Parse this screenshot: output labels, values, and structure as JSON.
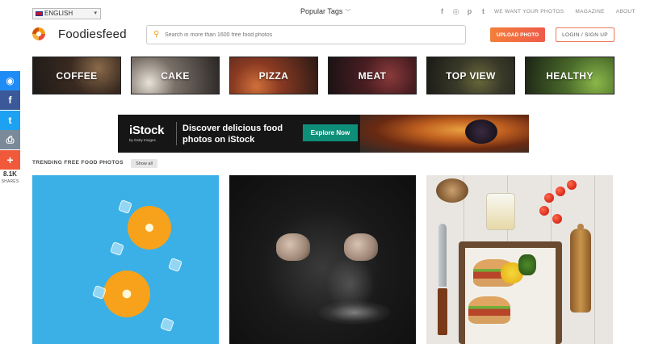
{
  "topbar": {
    "language": "ENGLISH",
    "popular_tags": "Popular Tags",
    "social_icons": [
      "facebook-icon",
      "instagram-icon",
      "pinterest-icon",
      "twitter-icon"
    ],
    "social_glyphs": [
      "f",
      "◎",
      "p",
      "t"
    ],
    "links": [
      "WE WANT YOUR PHOTOS",
      "MAGAZINE",
      "ABOUT"
    ]
  },
  "header": {
    "brand": "Foodiesfeed",
    "search_placeholder": "Search in more than 1600 free food photos",
    "upload_label": "UPLOAD PHOTO",
    "login_label": "LOGIN / SIGN UP"
  },
  "categories": [
    "COFFEE",
    "CAKE",
    "PIZZA",
    "MEAT",
    "TOP VIEW",
    "HEALTHY"
  ],
  "share_bar": {
    "buttons": [
      {
        "name": "messenger",
        "glyph": "◉"
      },
      {
        "name": "facebook",
        "glyph": "f"
      },
      {
        "name": "twitter",
        "glyph": "t"
      },
      {
        "name": "print",
        "glyph": "⎙"
      },
      {
        "name": "more",
        "glyph": "+"
      }
    ],
    "count": "8.1K",
    "label": "SHARES"
  },
  "banner": {
    "brand": "iStock",
    "sub": "by Getty Images",
    "headline": "Discover delicious food photos on iStock",
    "cta": "Explore Now"
  },
  "trending": {
    "title": "TRENDING FREE FOOD PHOTOS",
    "show_all": "Show all"
  },
  "colors": {
    "accent": "#f57f3a",
    "accent_end": "#ef5a4a",
    "istock_green": "#0e8f7a"
  }
}
